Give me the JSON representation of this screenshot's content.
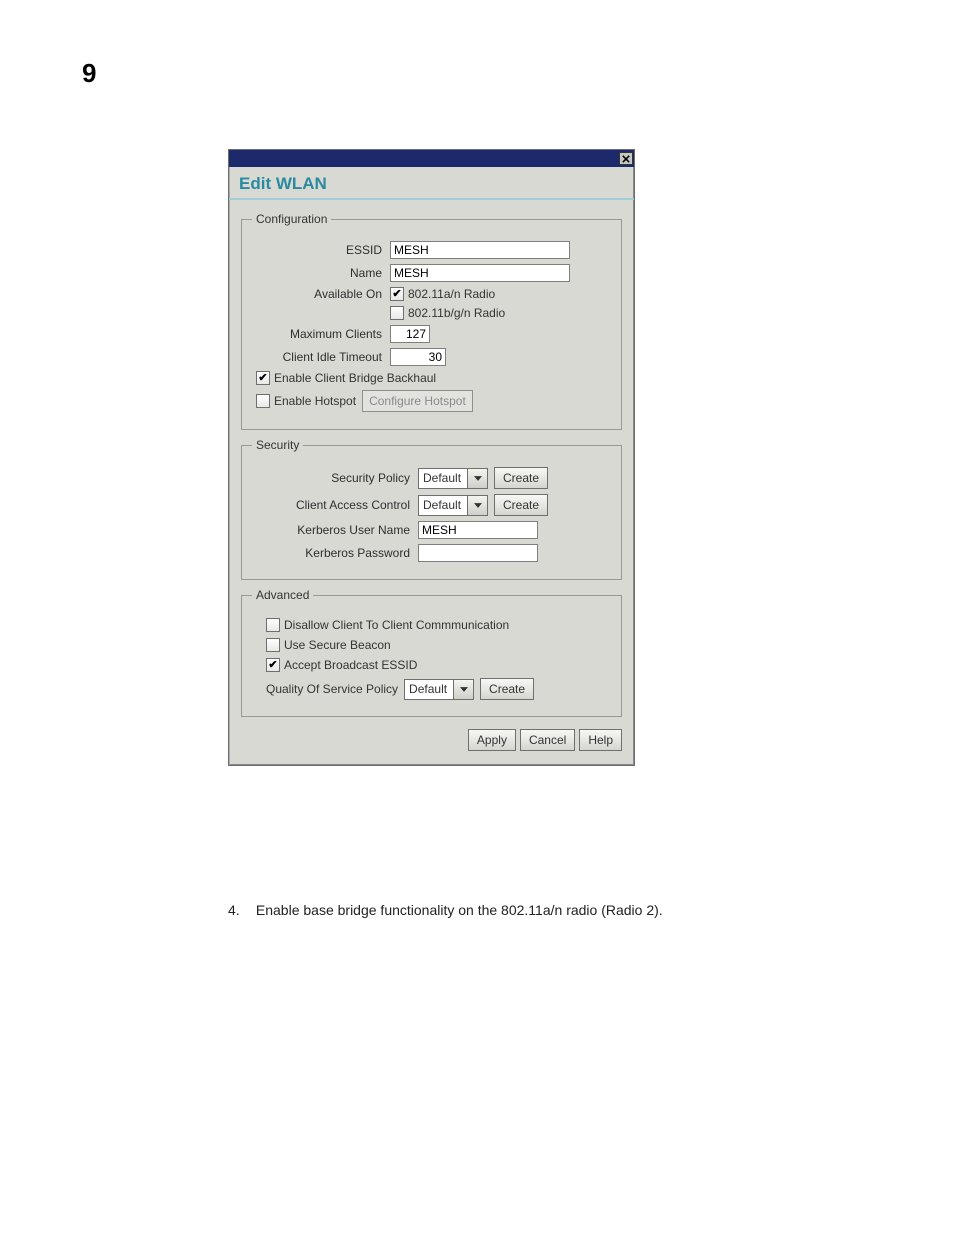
{
  "page_number": "9",
  "dialog": {
    "title": "Edit WLAN",
    "groups": {
      "configuration": {
        "legend": "Configuration",
        "essid_label": "ESSID",
        "essid_value": "MESH",
        "name_label": "Name",
        "name_value": "MESH",
        "available_on_label": "Available On",
        "radio_a_label": "802.11a/n Radio",
        "radio_a_checked": "✔",
        "radio_b_label": "802.11b/g/n Radio",
        "max_clients_label": "Maximum Clients",
        "max_clients_value": "127",
        "idle_timeout_label": "Client Idle Timeout",
        "idle_timeout_value": "30",
        "enable_bridge_label": "Enable Client Bridge Backhaul",
        "enable_bridge_checked": "✔",
        "enable_hotspot_label": "Enable Hotspot",
        "configure_hotspot_label": "Configure Hotspot"
      },
      "security": {
        "legend": "Security",
        "policy_label": "Security Policy",
        "policy_value": "Default",
        "acl_label": "Client Access Control",
        "acl_value": "Default",
        "kerberos_user_label": "Kerberos User Name",
        "kerberos_user_value": "MESH",
        "kerberos_pw_label": "Kerberos Password",
        "kerberos_pw_value": "",
        "create_label": "Create"
      },
      "advanced": {
        "legend": "Advanced",
        "disallow_c2c_label": "Disallow Client To Client Commmunication",
        "secure_beacon_label": "Use Secure Beacon",
        "accept_broadcast_label": "Accept Broadcast ESSID",
        "accept_broadcast_checked": "✔",
        "qos_label": "Quality Of Service Policy",
        "qos_value": "Default",
        "create_label": "Create"
      }
    },
    "footer": {
      "apply": "Apply",
      "cancel": "Cancel",
      "help": "Help"
    }
  },
  "instruction": {
    "number": "4.",
    "text": "Enable base bridge functionality on the 802.11a/n radio (Radio 2)."
  }
}
